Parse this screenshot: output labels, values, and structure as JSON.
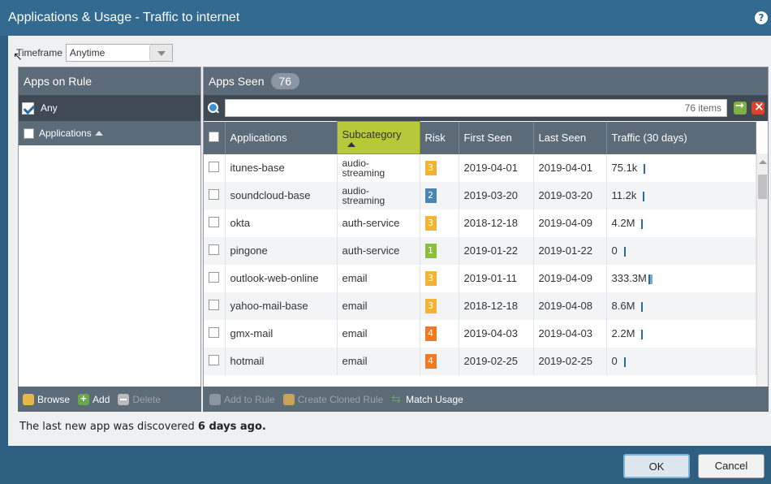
{
  "window": {
    "title": "Applications & Usage - Traffic to internet"
  },
  "timeframe": {
    "label": "Timeframe",
    "value": "Anytime"
  },
  "left": {
    "header": "Apps on Rule",
    "any_label": "Any",
    "applications_header": "Applications",
    "footer": {
      "browse": "Browse",
      "add": "Add",
      "delete": "Delete"
    }
  },
  "right": {
    "header": "Apps Seen",
    "count": "76",
    "search": {
      "items_text": "76 items"
    },
    "columns": [
      "Applications",
      "Subcategory",
      "Risk",
      "First Seen",
      "Last Seen",
      "Traffic (30 days)"
    ],
    "rows": [
      {
        "app": "itunes-base",
        "sub1": "audio-",
        "sub2": "streaming",
        "risk": "3",
        "risk_color": "#f5b335",
        "first": "2019-04-01",
        "last": "2019-04-01",
        "traffic": "75.1k"
      },
      {
        "app": "soundcloud-base",
        "sub1": "audio-",
        "sub2": "streaming",
        "risk": "2",
        "risk_color": "#4a86b4",
        "first": "2019-03-20",
        "last": "2019-03-20",
        "traffic": "11.2k"
      },
      {
        "app": "okta",
        "sub1": "auth-service",
        "sub2": "",
        "risk": "3",
        "risk_color": "#f5b335",
        "first": "2018-12-18",
        "last": "2019-04-09",
        "traffic": "4.2M"
      },
      {
        "app": "pingone",
        "sub1": "auth-service",
        "sub2": "",
        "risk": "1",
        "risk_color": "#8cbf3f",
        "first": "2019-01-22",
        "last": "2019-01-22",
        "traffic": "0"
      },
      {
        "app": "outlook-web-online",
        "sub1": "email",
        "sub2": "",
        "risk": "3",
        "risk_color": "#f5b335",
        "first": "2019-01-11",
        "last": "2019-04-09",
        "traffic": "333.3M"
      },
      {
        "app": "yahoo-mail-base",
        "sub1": "email",
        "sub2": "",
        "risk": "3",
        "risk_color": "#f5b335",
        "first": "2018-12-18",
        "last": "2019-04-08",
        "traffic": "8.6M"
      },
      {
        "app": "gmx-mail",
        "sub1": "email",
        "sub2": "",
        "risk": "4",
        "risk_color": "#ee7a25",
        "first": "2019-04-03",
        "last": "2019-04-03",
        "traffic": "2.2M"
      },
      {
        "app": "hotmail",
        "sub1": "email",
        "sub2": "",
        "risk": "4",
        "risk_color": "#ee7a25",
        "first": "2019-02-25",
        "last": "2019-02-25",
        "traffic": "0"
      }
    ],
    "footer": {
      "add_to_rule": "Add to Rule",
      "create_cloned": "Create Cloned Rule",
      "match_usage": "Match Usage"
    }
  },
  "status": {
    "prefix": "The last new app was discovered ",
    "bold": "6 days ago."
  },
  "buttons": {
    "ok": "OK",
    "cancel": "Cancel"
  }
}
